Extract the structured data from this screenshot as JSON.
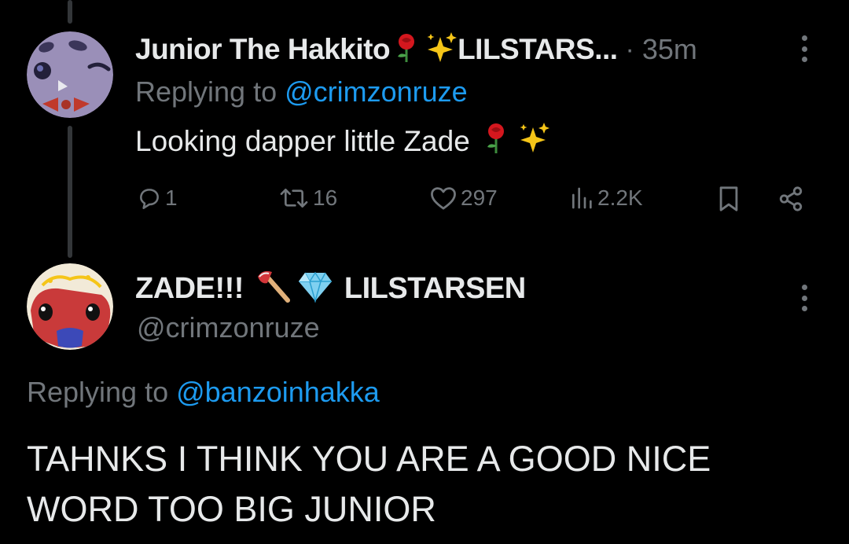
{
  "tweet1": {
    "display_name": "Junior The Hakkito",
    "name_suffix": "LILSTARS...",
    "separator": "·",
    "time": "35m",
    "replying_label": "Replying to",
    "replying_handle": "@crimzonruze",
    "text": "Looking dapper little Zade",
    "name_emojis": [
      "rose-emoji",
      "sparkles-emoji"
    ],
    "text_emojis": [
      "rose-emoji",
      "sparkles-emoji"
    ],
    "actions": {
      "replies": "1",
      "retweets": "16",
      "likes": "297",
      "views": "2.2K"
    }
  },
  "tweet2": {
    "display_name": "ZADE!!!",
    "name_suffix": "LILSTARSEN",
    "name_emojis": [
      "axe-emoji",
      "gem-emoji"
    ],
    "handle": "@crimzonruze",
    "replying_label": "Replying to",
    "replying_handle": "@banzoinhakka",
    "text_line1": "TAHNKS I THINK YOU ARE A GOOD NICE",
    "text_line2": "WORD TOO BIG JUNIOR"
  },
  "colors": {
    "background": "#000000",
    "text": "#e7e9ea",
    "muted": "#71767b",
    "link": "#1d9bf0",
    "thread_line": "#333639"
  }
}
